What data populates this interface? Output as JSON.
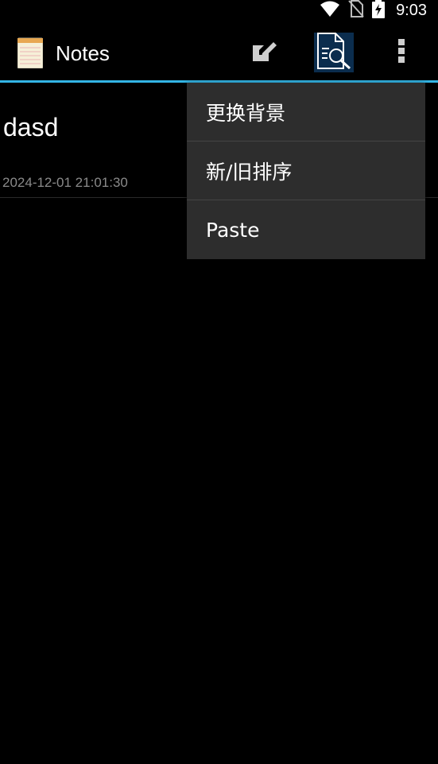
{
  "status_bar": {
    "time": "9:03",
    "icons": [
      "wifi-icon",
      "no-sim-icon",
      "battery-charging-icon"
    ]
  },
  "action_bar": {
    "title": "Notes",
    "app_icon": "notepad-icon",
    "actions": [
      "new-note-icon",
      "search-note-icon",
      "overflow-menu-icon"
    ],
    "accent_color": "#33b5e5"
  },
  "notes": [
    {
      "title": "dasd",
      "date": "2024-12-01 21:01:30"
    }
  ],
  "popup_menu": {
    "items": [
      {
        "label": "更换背景"
      },
      {
        "label": "新/旧排序"
      },
      {
        "label": "Paste"
      }
    ]
  }
}
